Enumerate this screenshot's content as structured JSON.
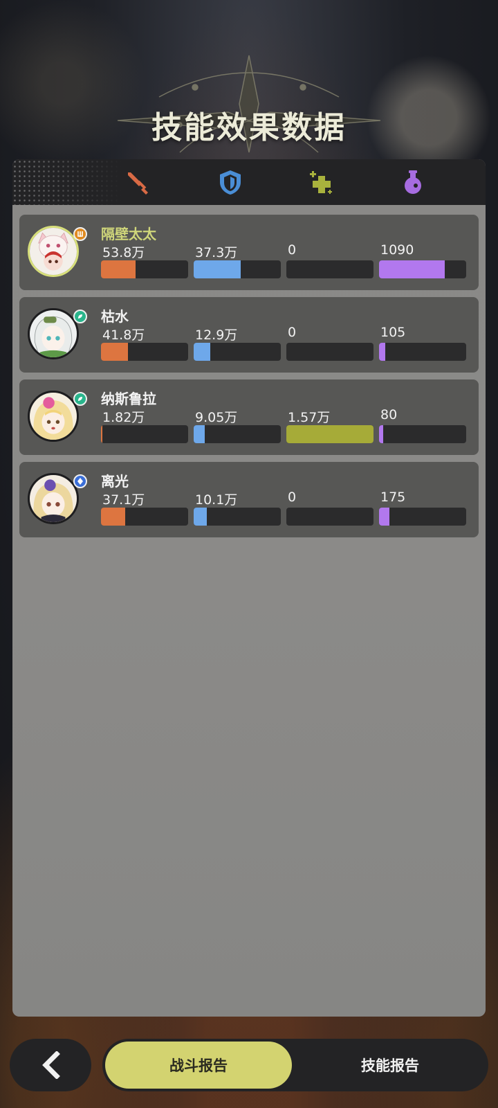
{
  "page": {
    "title": "技能效果数据"
  },
  "tabs": [
    {
      "icon": "sword-icon",
      "color": "#d86a45"
    },
    {
      "icon": "shield-icon",
      "color": "#4a8ed6"
    },
    {
      "icon": "heal-plus-icon",
      "color": "#a9b23d"
    },
    {
      "icon": "potion-icon",
      "color": "#a66ce0"
    }
  ],
  "stat_colors": [
    "#dd7540",
    "#6ea8ea",
    "#a6ab38",
    "#b278ee"
  ],
  "characters": [
    {
      "name": "隔壁太太",
      "highlight": true,
      "element_badge_color": "#e08a20",
      "stats": [
        {
          "label": "53.8万",
          "fill": 0.4
        },
        {
          "label": "37.3万",
          "fill": 0.54
        },
        {
          "label": "0",
          "fill": 0
        },
        {
          "label": "1090",
          "fill": 0.75
        }
      ]
    },
    {
      "name": "枯水",
      "highlight": false,
      "element_badge_color": "#2ab58c",
      "stats": [
        {
          "label": "41.8万",
          "fill": 0.31
        },
        {
          "label": "12.9万",
          "fill": 0.19
        },
        {
          "label": "0",
          "fill": 0
        },
        {
          "label": "105",
          "fill": 0.07
        }
      ]
    },
    {
      "name": "纳斯鲁拉",
      "highlight": false,
      "element_badge_color": "#2ab58c",
      "stats": [
        {
          "label": "1.82万",
          "fill": 0.015
        },
        {
          "label": "9.05万",
          "fill": 0.13
        },
        {
          "label": "1.57万",
          "fill": 1.0
        },
        {
          "label": "80",
          "fill": 0.05
        }
      ]
    },
    {
      "name": "离光",
      "highlight": false,
      "element_badge_color": "#3b6fd8",
      "stats": [
        {
          "label": "37.1万",
          "fill": 0.28
        },
        {
          "label": "10.1万",
          "fill": 0.15
        },
        {
          "label": "0",
          "fill": 0
        },
        {
          "label": "175",
          "fill": 0.12
        }
      ]
    }
  ],
  "bottom_nav": {
    "active_label": "战斗报告",
    "inactive_label": "技能报告"
  }
}
